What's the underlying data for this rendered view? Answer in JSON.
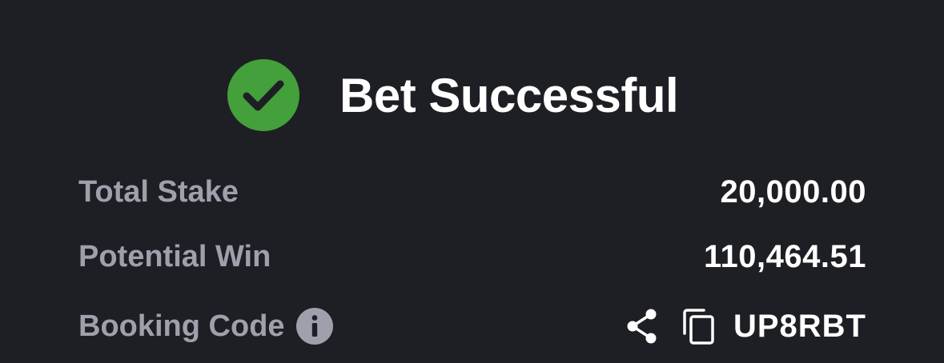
{
  "header": {
    "title": "Bet Successful",
    "icon": "check-circle-icon",
    "accent_color": "#43a03a"
  },
  "summary": {
    "total_stake_label": "Total Stake",
    "total_stake_value": "20,000.00",
    "potential_win_label": "Potential Win",
    "potential_win_value": "110,464.51",
    "booking_code_label": "Booking Code",
    "booking_code_value": "UP8RBT"
  },
  "icons": {
    "info": "info-icon",
    "share": "share-icon",
    "copy": "copy-icon"
  },
  "colors": {
    "background": "#1e1f24",
    "label": "#9ea1ab",
    "value": "#ffffff"
  }
}
